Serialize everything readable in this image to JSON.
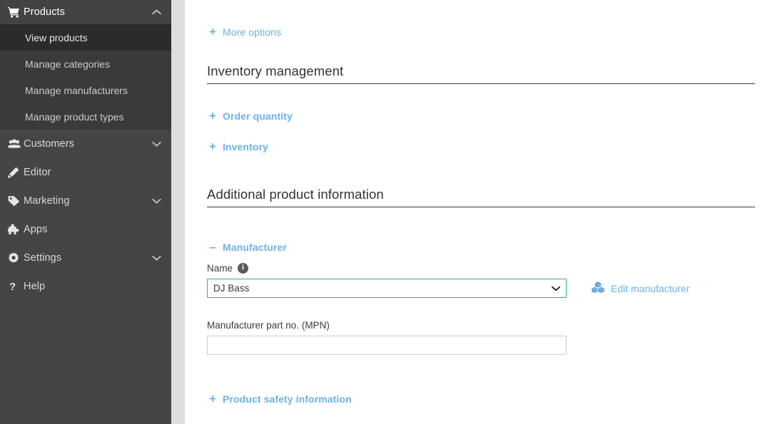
{
  "sidebar": {
    "group": {
      "label": "Products",
      "icon": "shopping-cart-icon",
      "caret": "chevron-up-icon",
      "items": [
        {
          "label": "View products",
          "active": true
        },
        {
          "label": "Manage categories",
          "active": false
        },
        {
          "label": "Manage manufacturers",
          "active": false
        },
        {
          "label": "Manage product types",
          "active": false
        }
      ]
    },
    "items": [
      {
        "label": "Customers",
        "icon": "users-icon",
        "caret": "chevron-down-icon"
      },
      {
        "label": "Editor",
        "icon": "pencil-icon",
        "caret": ""
      },
      {
        "label": "Marketing",
        "icon": "tag-icon",
        "caret": "chevron-down-icon"
      },
      {
        "label": "Apps",
        "icon": "puzzle-piece-icon",
        "caret": ""
      },
      {
        "label": "Settings",
        "icon": "gear-icon",
        "caret": "chevron-down-icon"
      },
      {
        "label": "Help",
        "icon": "question-mark-icon",
        "caret": ""
      }
    ]
  },
  "main": {
    "more_options": {
      "label": "More options",
      "toggle": "+"
    },
    "inventory_section": {
      "title": "Inventory management",
      "links": [
        {
          "label": "Order quantity",
          "toggle": "+"
        },
        {
          "label": "Inventory",
          "toggle": "+"
        }
      ]
    },
    "additional_section": {
      "title": "Additional product information",
      "manufacturer": {
        "toggle": "–",
        "label": "Manufacturer",
        "name_label": "Name",
        "name_info_icon": "info-icon",
        "name_value": "DJ Bass",
        "name_caret": "chevron-down-icon",
        "edit_link": "Edit manufacturer",
        "edit_link_icon": "cubes-icon",
        "mpn_label": "Manufacturer part no. (MPN)",
        "mpn_value": "",
        "mpn_placeholder": ""
      },
      "safety_link": {
        "label": "Product safety information",
        "toggle": "+"
      }
    }
  },
  "colors": {
    "link_blue": "#6cb2e8",
    "sidebar_bg": "#454545",
    "submenu_bg": "#3a3a3a",
    "submenu_active_bg": "#2b2b2b",
    "select_focus_border": "#3aa69a",
    "gutter": "#dedede"
  }
}
